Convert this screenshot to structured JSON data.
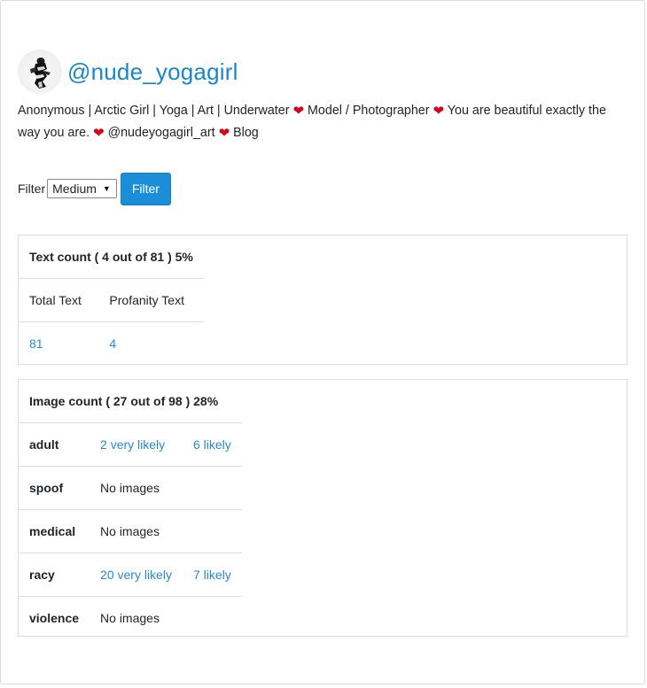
{
  "profile": {
    "handle": "@nude_yogagirl",
    "bio_segments": [
      "Anonymous | Arctic Girl | Yoga | Art | Underwater ",
      " Model / Photographer ",
      " You are beautiful exactly the way you are. ",
      " @nudeyogagirl_art ",
      " Blog"
    ],
    "heart_icon": "heart-icon",
    "heart_color": "#d0021b"
  },
  "filter": {
    "label": "Filter",
    "selected": "Medium",
    "button_label": "Filter",
    "accent": "#1a8ed6"
  },
  "text_count": {
    "title": "Text count ( 4 out of 81 ) 5%",
    "columns": [
      "Total Text",
      "Profanity Text"
    ],
    "values": [
      "81",
      "4"
    ]
  },
  "image_count": {
    "title": "Image count ( 27 out of 98 ) 28%",
    "rows": [
      {
        "label": "adult",
        "very_likely": "2 very likely",
        "likely": "6 likely"
      },
      {
        "label": "spoof",
        "none": "No images"
      },
      {
        "label": "medical",
        "none": "No images"
      },
      {
        "label": "racy",
        "very_likely": "20 very likely",
        "likely": "7 likely"
      },
      {
        "label": "violence",
        "none": "No images"
      }
    ]
  },
  "colors": {
    "link": "#2a88c6",
    "handle": "#1a86c8",
    "border": "#dedede"
  }
}
